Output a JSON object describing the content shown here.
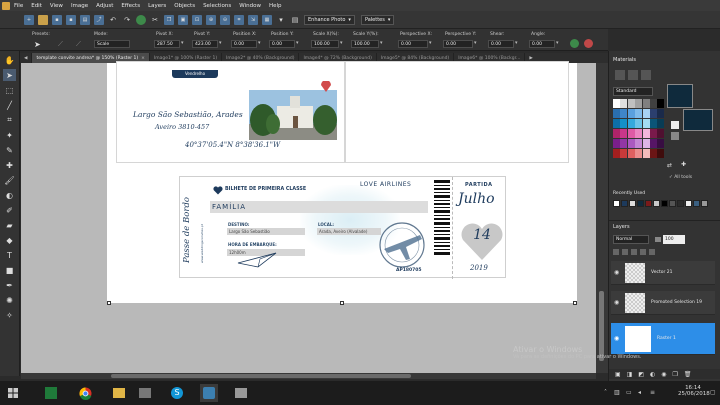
{
  "menu": [
    "File",
    "Edit",
    "View",
    "Image",
    "Adjust",
    "Effects",
    "Layers",
    "Objects",
    "Selections",
    "Window",
    "Help"
  ],
  "toolbar": {
    "enhance_label": "Enhance Photo",
    "palettes_label": "Palettes"
  },
  "tool_options": {
    "presets_label": "Presets:",
    "mode_label": "Mode:",
    "mode_value": "Scale",
    "fields": [
      {
        "label": "Pivot X:",
        "value": "287.50"
      },
      {
        "label": "Pivot Y:",
        "value": "423.00"
      },
      {
        "label": "Position X:",
        "value": "0.00"
      },
      {
        "label": "Position Y:",
        "value": "0.00"
      },
      {
        "label": "Scale X(%):",
        "value": "100.00"
      },
      {
        "label": "Scale Y(%):",
        "value": "100.00"
      },
      {
        "label": "Perspective X:",
        "value": "0.00"
      },
      {
        "label": "Perspective Y:",
        "value": "0.00"
      },
      {
        "label": "Shear:",
        "value": "0.00"
      },
      {
        "label": "Angle:",
        "value": "0.00"
      }
    ]
  },
  "tabs": [
    {
      "label": "template convite andrea* @ 150% (Raster 1)",
      "active": true
    },
    {
      "label": "Image1* @ 100% (Raster 1)",
      "active": false
    },
    {
      "label": "Image2* @ 40% (Background)",
      "active": false
    },
    {
      "label": "Image4* @ 72% (Background)",
      "active": false
    },
    {
      "label": "Image5* @ 84% (Background)",
      "active": false
    },
    {
      "label": "Image6* @ 100% (Backgr...",
      "active": false
    }
  ],
  "document": {
    "header_fragment": "Vendrelho",
    "address_line1": "Largo São Sebastião, Arades",
    "address_line2": "Aveiro 3810-457",
    "coords": "40°37'05.4\"N 8°38'36.1\"W",
    "ticket": {
      "side_text": "Passe de Bordo",
      "side_url": "www.weddingsconvites.pt",
      "class_text": "BILHETE DE PRIMEIRA CLASSE",
      "airline": "LOVE AIRLINES",
      "family": "FAMÍLIA",
      "destino_label": "DESTINO:",
      "destino_value": "Largo São Sebastião",
      "local_label": "LOCAL:",
      "local_value": "Arada, Aveiro (Alvalade)",
      "hora_label": "HORA DE EMBARQUE:",
      "hora_value": "12h00m",
      "code": "AP180705",
      "partida": "PARTIDA",
      "month": "Julho",
      "day": "14",
      "year": "2019"
    }
  },
  "right_panel": {
    "materials_title": "Materials",
    "palette_select": "Standard",
    "all_tools": "All tools",
    "recent_title": "Recently Used",
    "layers_title": "Layers",
    "blend_mode": "Normal",
    "opacity": "100",
    "layers": [
      {
        "name": "Vector 21",
        "selected": false
      },
      {
        "name": "Promoted Selection 19",
        "selected": false
      },
      {
        "name": "Raster 1",
        "selected": true
      }
    ]
  },
  "activation": {
    "title": "Ativar o Windows",
    "subtitle": "Vá para as definições do PC para ativar o Windows."
  },
  "taskbar": {
    "time": "16:14",
    "date": "25/06/2018"
  },
  "colors": {
    "accent": "#2d8ee8",
    "navy": "#1d3a5c",
    "foreground_swatch": "#0f2a3c"
  },
  "icons": [
    "windows-start-icon",
    "excel-icon",
    "chrome-icon",
    "explorer-icon",
    "film-icon",
    "skype-icon",
    "paintshop-icon",
    "gallery-icon"
  ]
}
